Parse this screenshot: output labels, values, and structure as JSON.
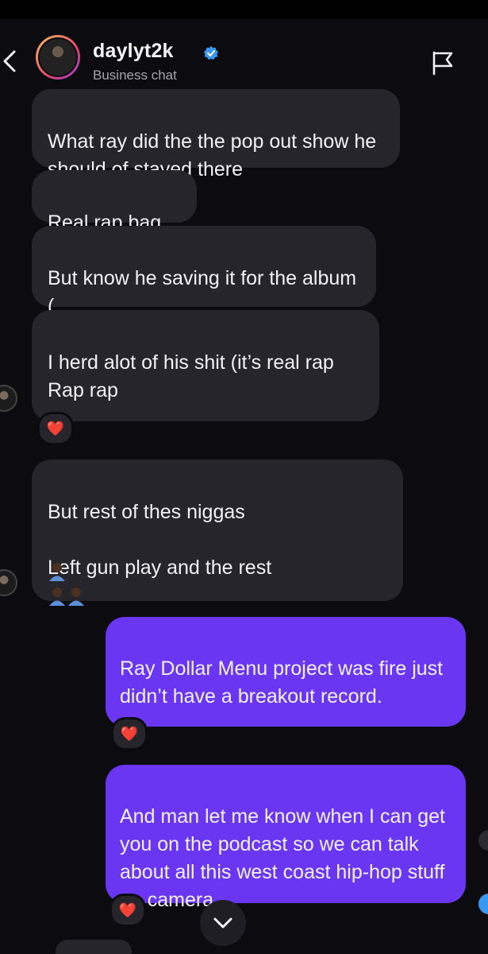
{
  "header": {
    "username": "daylyt2k",
    "subtitle": "Business chat"
  },
  "messages": [
    {
      "sender": "them",
      "text": "What ray  did the the pop out show he should of stayed there"
    },
    {
      "sender": "them",
      "text": "Real rap bag"
    },
    {
      "sender": "them",
      "text": "But know he saving it for the album ("
    },
    {
      "sender": "them",
      "text": "I herd alot of his shit (it’s real rap\nRap rap",
      "reaction": "❤️"
    },
    {
      "sender": "them",
      "text": "But rest of thes niggas\n\nLeft gun play and the rest",
      "emoji_count": 3
    },
    {
      "sender": "me",
      "text": "Ray Dollar Menu project was fire just didn’t have a breakout record.",
      "reaction": "❤️"
    },
    {
      "sender": "me",
      "text": "And man let me know when I can get you on the podcast so we can talk about all this west coast hip-hop stuff on camera.",
      "reaction": "❤️"
    }
  ],
  "icons": {
    "back": "chevron-left-icon",
    "verified": "verified-badge-icon",
    "report": "flag-icon",
    "scroll": "chevron-down-icon",
    "reaction": "red-heart-icon"
  },
  "colors": {
    "background": "#0c0b10",
    "incoming_bubble": "#26252c",
    "outgoing_bubble": "#6a36f2",
    "verified": "#3897f0",
    "heart": "#ef2b3a"
  }
}
